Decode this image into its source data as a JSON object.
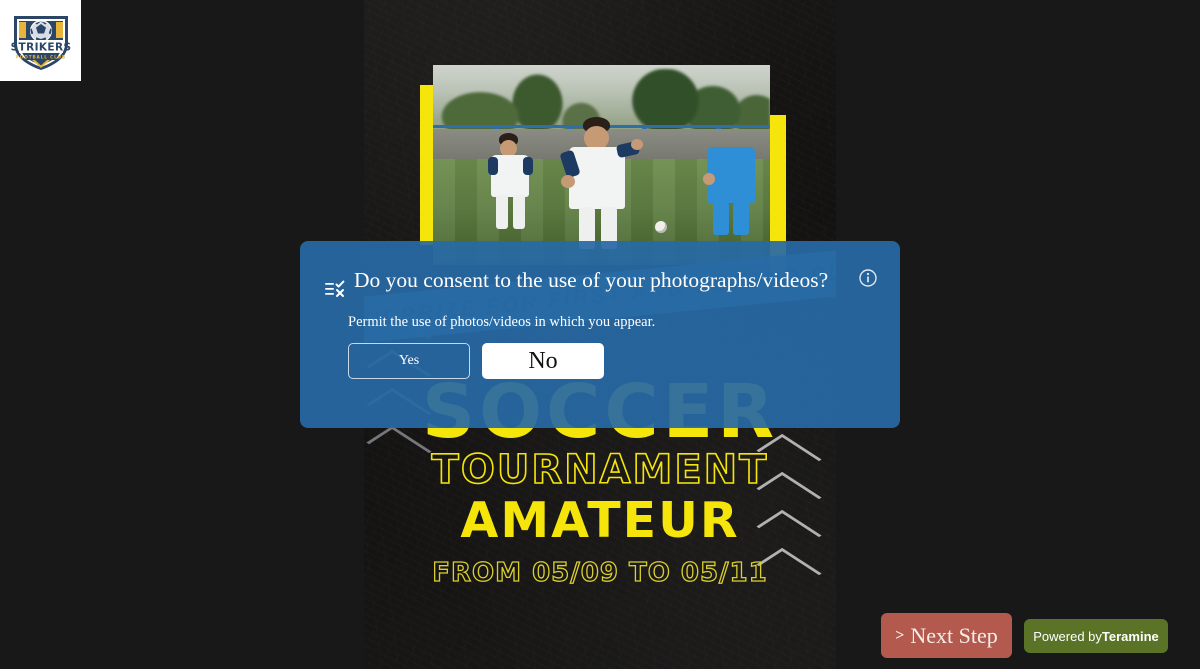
{
  "page": {
    "background_color": "#181818"
  },
  "logo": {
    "name": "strikers-football-club-logo",
    "primary_text": "STRIKERS",
    "secondary_text": "FOOTBALL CLUB",
    "navy": "#28405e",
    "yellow": "#e8b53a"
  },
  "poster": {
    "headline": "SOCCER",
    "subheadline": "TOURNAMENT",
    "tier": "AMATEUR",
    "dates": "FROM 05/09 TO 05/11",
    "ribbon_text": "CASH PRIZE FOR FIRST AND SECOND PLACE",
    "accent_yellow": "#f5e50a",
    "ribbon_blue": "#3e7cb7"
  },
  "dialog": {
    "icon": "checklist-icon",
    "title": "Do you consent to the use of your photographs/videos?",
    "subtitle": "Permit the use of photos/videos in which you appear.",
    "info_icon": "info-circle-icon",
    "background_color": "#2769a5",
    "buttons": {
      "yes": "Yes",
      "no": "No"
    }
  },
  "footer": {
    "next_step_label": "Next Step",
    "next_step_chevron": ">",
    "next_step_color": "#b3594e",
    "powered_prefix": "Powered by",
    "powered_brand": "Teramine",
    "powered_color": "#5a7326"
  }
}
